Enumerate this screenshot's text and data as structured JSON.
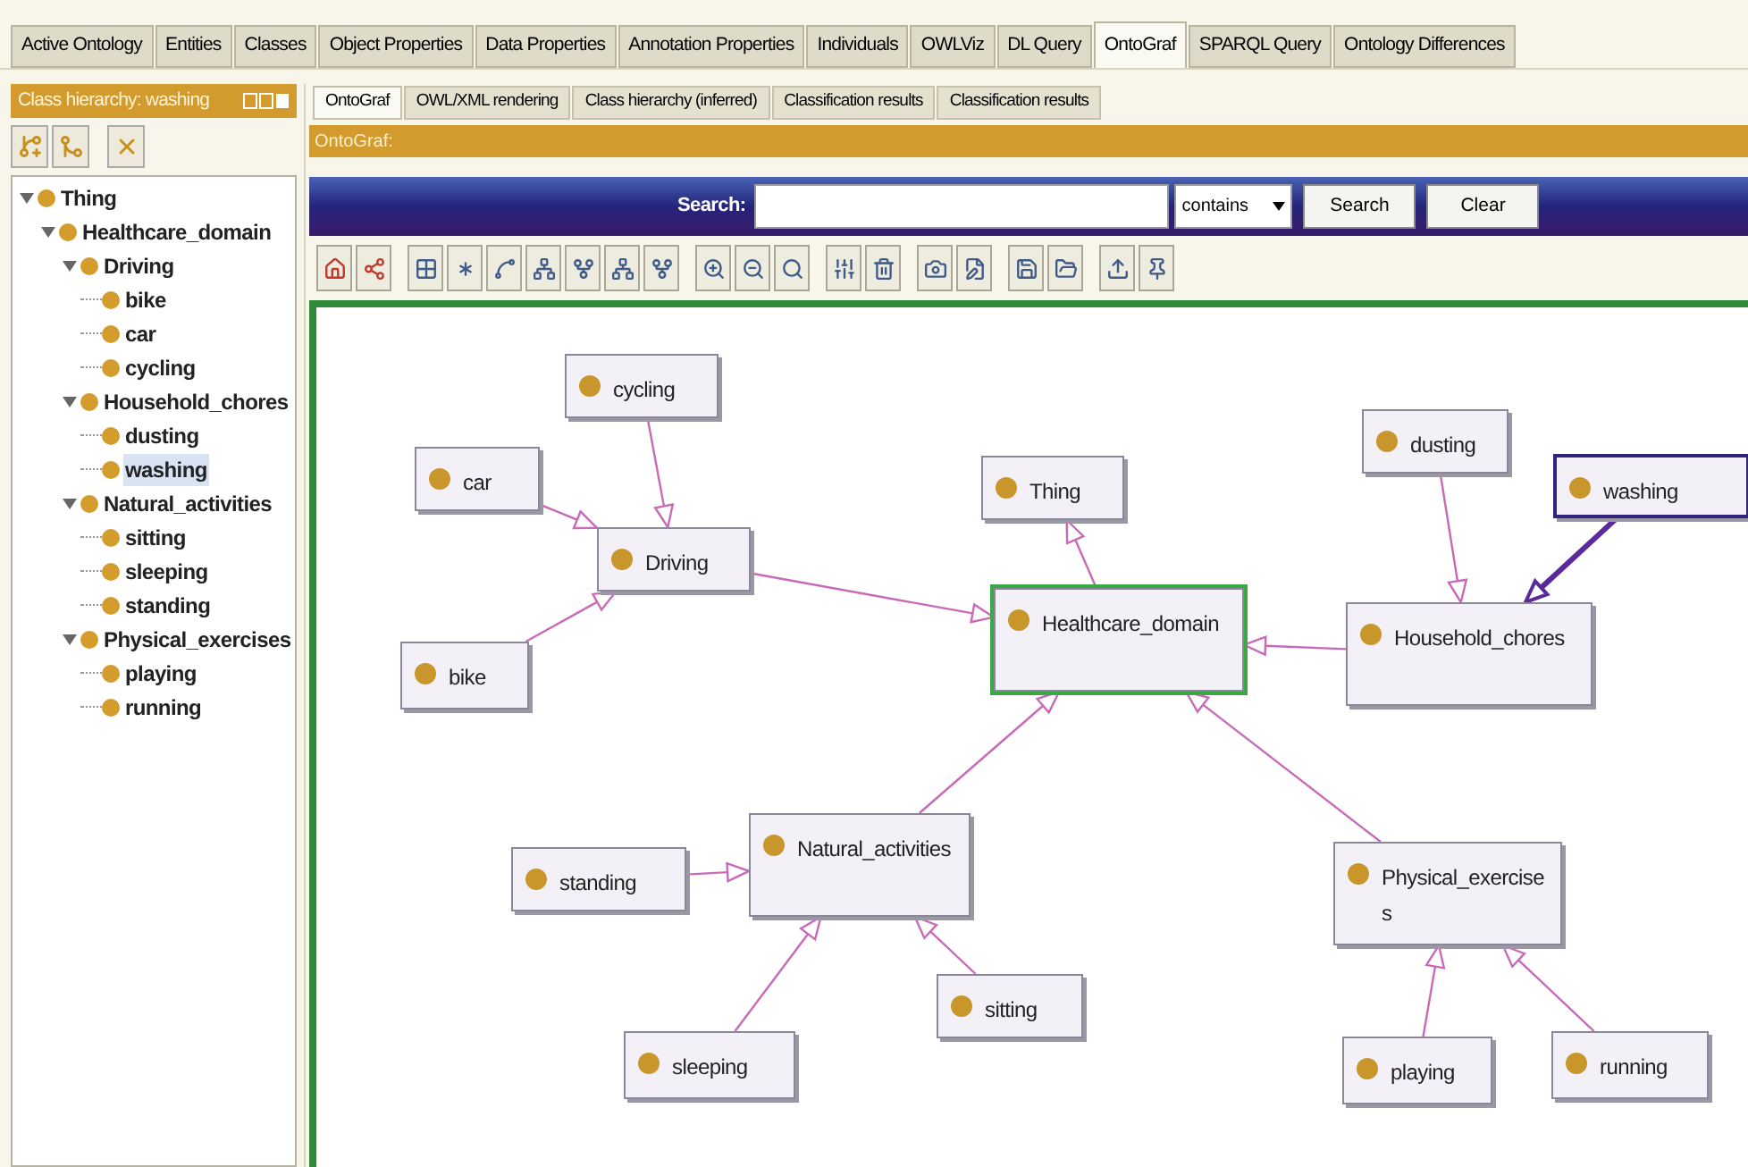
{
  "main_tabs": [
    {
      "label": "Active Ontology",
      "selected": false
    },
    {
      "label": "Entities",
      "selected": false
    },
    {
      "label": "Classes",
      "selected": false
    },
    {
      "label": "Object Properties",
      "selected": false
    },
    {
      "label": "Data Properties",
      "selected": false
    },
    {
      "label": "Annotation Properties",
      "selected": false
    },
    {
      "label": "Individuals",
      "selected": false
    },
    {
      "label": "OWLViz",
      "selected": false
    },
    {
      "label": "DL Query",
      "selected": false
    },
    {
      "label": "OntoGraf",
      "selected": true
    },
    {
      "label": "SPARQL Query",
      "selected": false
    },
    {
      "label": "Ontology Differences",
      "selected": false
    }
  ],
  "class_hierarchy": {
    "title": "Class hierarchy: washing",
    "tree": [
      {
        "label": "Thing",
        "expanded": true,
        "selected": false,
        "children": [
          {
            "label": "Healthcare_domain",
            "expanded": true,
            "selected": false,
            "children": [
              {
                "label": "Driving",
                "expanded": true,
                "selected": false,
                "children": [
                  {
                    "label": "bike",
                    "selected": false
                  },
                  {
                    "label": "car",
                    "selected": false
                  },
                  {
                    "label": "cycling",
                    "selected": false
                  }
                ]
              },
              {
                "label": "Household_chores",
                "expanded": true,
                "selected": false,
                "children": [
                  {
                    "label": "dusting",
                    "selected": false
                  },
                  {
                    "label": "washing",
                    "selected": true
                  }
                ]
              },
              {
                "label": "Natural_activities",
                "expanded": true,
                "selected": false,
                "children": [
                  {
                    "label": "sitting",
                    "selected": false
                  },
                  {
                    "label": "sleeping",
                    "selected": false
                  },
                  {
                    "label": "standing",
                    "selected": false
                  }
                ]
              },
              {
                "label": "Physical_exercises",
                "expanded": true,
                "selected": false,
                "children": [
                  {
                    "label": "playing",
                    "selected": false
                  },
                  {
                    "label": "running",
                    "selected": false
                  }
                ]
              }
            ]
          }
        ]
      }
    ]
  },
  "view_tabs": [
    {
      "label": "OntoGraf",
      "selected": true
    },
    {
      "label": "OWL/XML rendering",
      "selected": false
    },
    {
      "label": "Class hierarchy (inferred)",
      "selected": false
    },
    {
      "label": "Classification results",
      "selected": false
    },
    {
      "label": "Classification results",
      "selected": false
    }
  ],
  "ontograf": {
    "title": "OntoGraf:",
    "search": {
      "label": "Search:",
      "mode": "contains",
      "buttons": [
        "Search",
        "Clear"
      ]
    },
    "graph": [
      {
        "label": "Thing",
        "selected": false,
        "focused": false,
        "children": [
          {
            "label": "Healthcare_domain",
            "selected": false,
            "focused": true,
            "children": [
              {
                "label": "Driving",
                "selected": false,
                "focused": false,
                "children": [
                  {
                    "label": "bike",
                    "selected": false,
                    "focused": false
                  },
                  {
                    "label": "car",
                    "selected": false,
                    "focused": false
                  },
                  {
                    "label": "cycling",
                    "selected": false,
                    "focused": false
                  }
                ]
              },
              {
                "label": "Household_chores",
                "selected": false,
                "focused": false,
                "children": [
                  {
                    "label": "dusting",
                    "selected": false,
                    "focused": false
                  },
                  {
                    "label": "washing",
                    "selected": true,
                    "focused": false
                  }
                ]
              },
              {
                "label": "Natural_activities",
                "selected": false,
                "focused": false,
                "children": [
                  {
                    "label": "sitting",
                    "selected": false,
                    "focused": false
                  },
                  {
                    "label": "sleeping",
                    "selected": false,
                    "focused": false
                  },
                  {
                    "label": "standing",
                    "selected": false,
                    "focused": false
                  }
                ]
              },
              {
                "label": "Physical_exercises",
                "selected": false,
                "focused": false,
                "children": [
                  {
                    "label": "playing",
                    "selected": false,
                    "focused": false
                  },
                  {
                    "label": "running",
                    "selected": false,
                    "focused": false
                  }
                ]
              }
            ]
          }
        ]
      }
    ]
  }
}
